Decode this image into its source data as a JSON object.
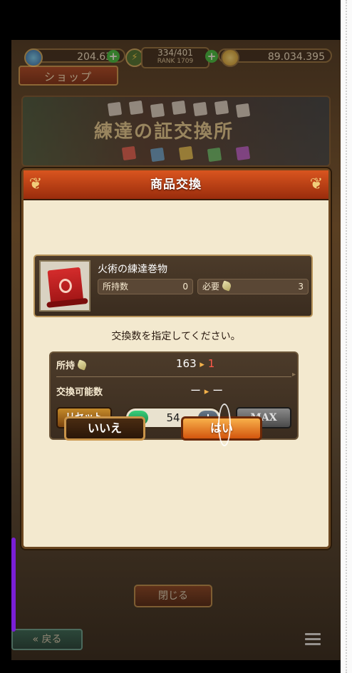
{
  "status": {
    "gems": "204.639",
    "stamina": "334/401",
    "rank": "RANK 1709",
    "gold": "89.034.395"
  },
  "shop_tab_label": "ショップ",
  "banner_title": "練達の証交換所",
  "modal": {
    "title": "商品交換",
    "item": {
      "name": "火術の練達巻物",
      "owned_label": "所持数",
      "owned_value": "0",
      "required_label": "必要",
      "required_value": "3"
    },
    "prompt": "交換数を指定してください。",
    "holdings": {
      "label": "所持",
      "current": "163",
      "after": "1"
    },
    "exchangeable": {
      "label": "交換可能数",
      "current": "ー",
      "after": "ー"
    },
    "reset_label": "リセット",
    "quantity": "54",
    "minus_label": "−",
    "plus_label": "+",
    "max_label": "MAX",
    "no_label": "いいえ",
    "yes_label": "はい"
  },
  "close_label": "閉じる",
  "back_label": "戻る",
  "icons": {
    "gem": "gem-icon",
    "stamina": "lightning-icon",
    "gold": "coin-icon",
    "trowel": "trowel-icon",
    "scroll": "fire-scroll-icon",
    "menu": "hamburger-menu-icon"
  }
}
